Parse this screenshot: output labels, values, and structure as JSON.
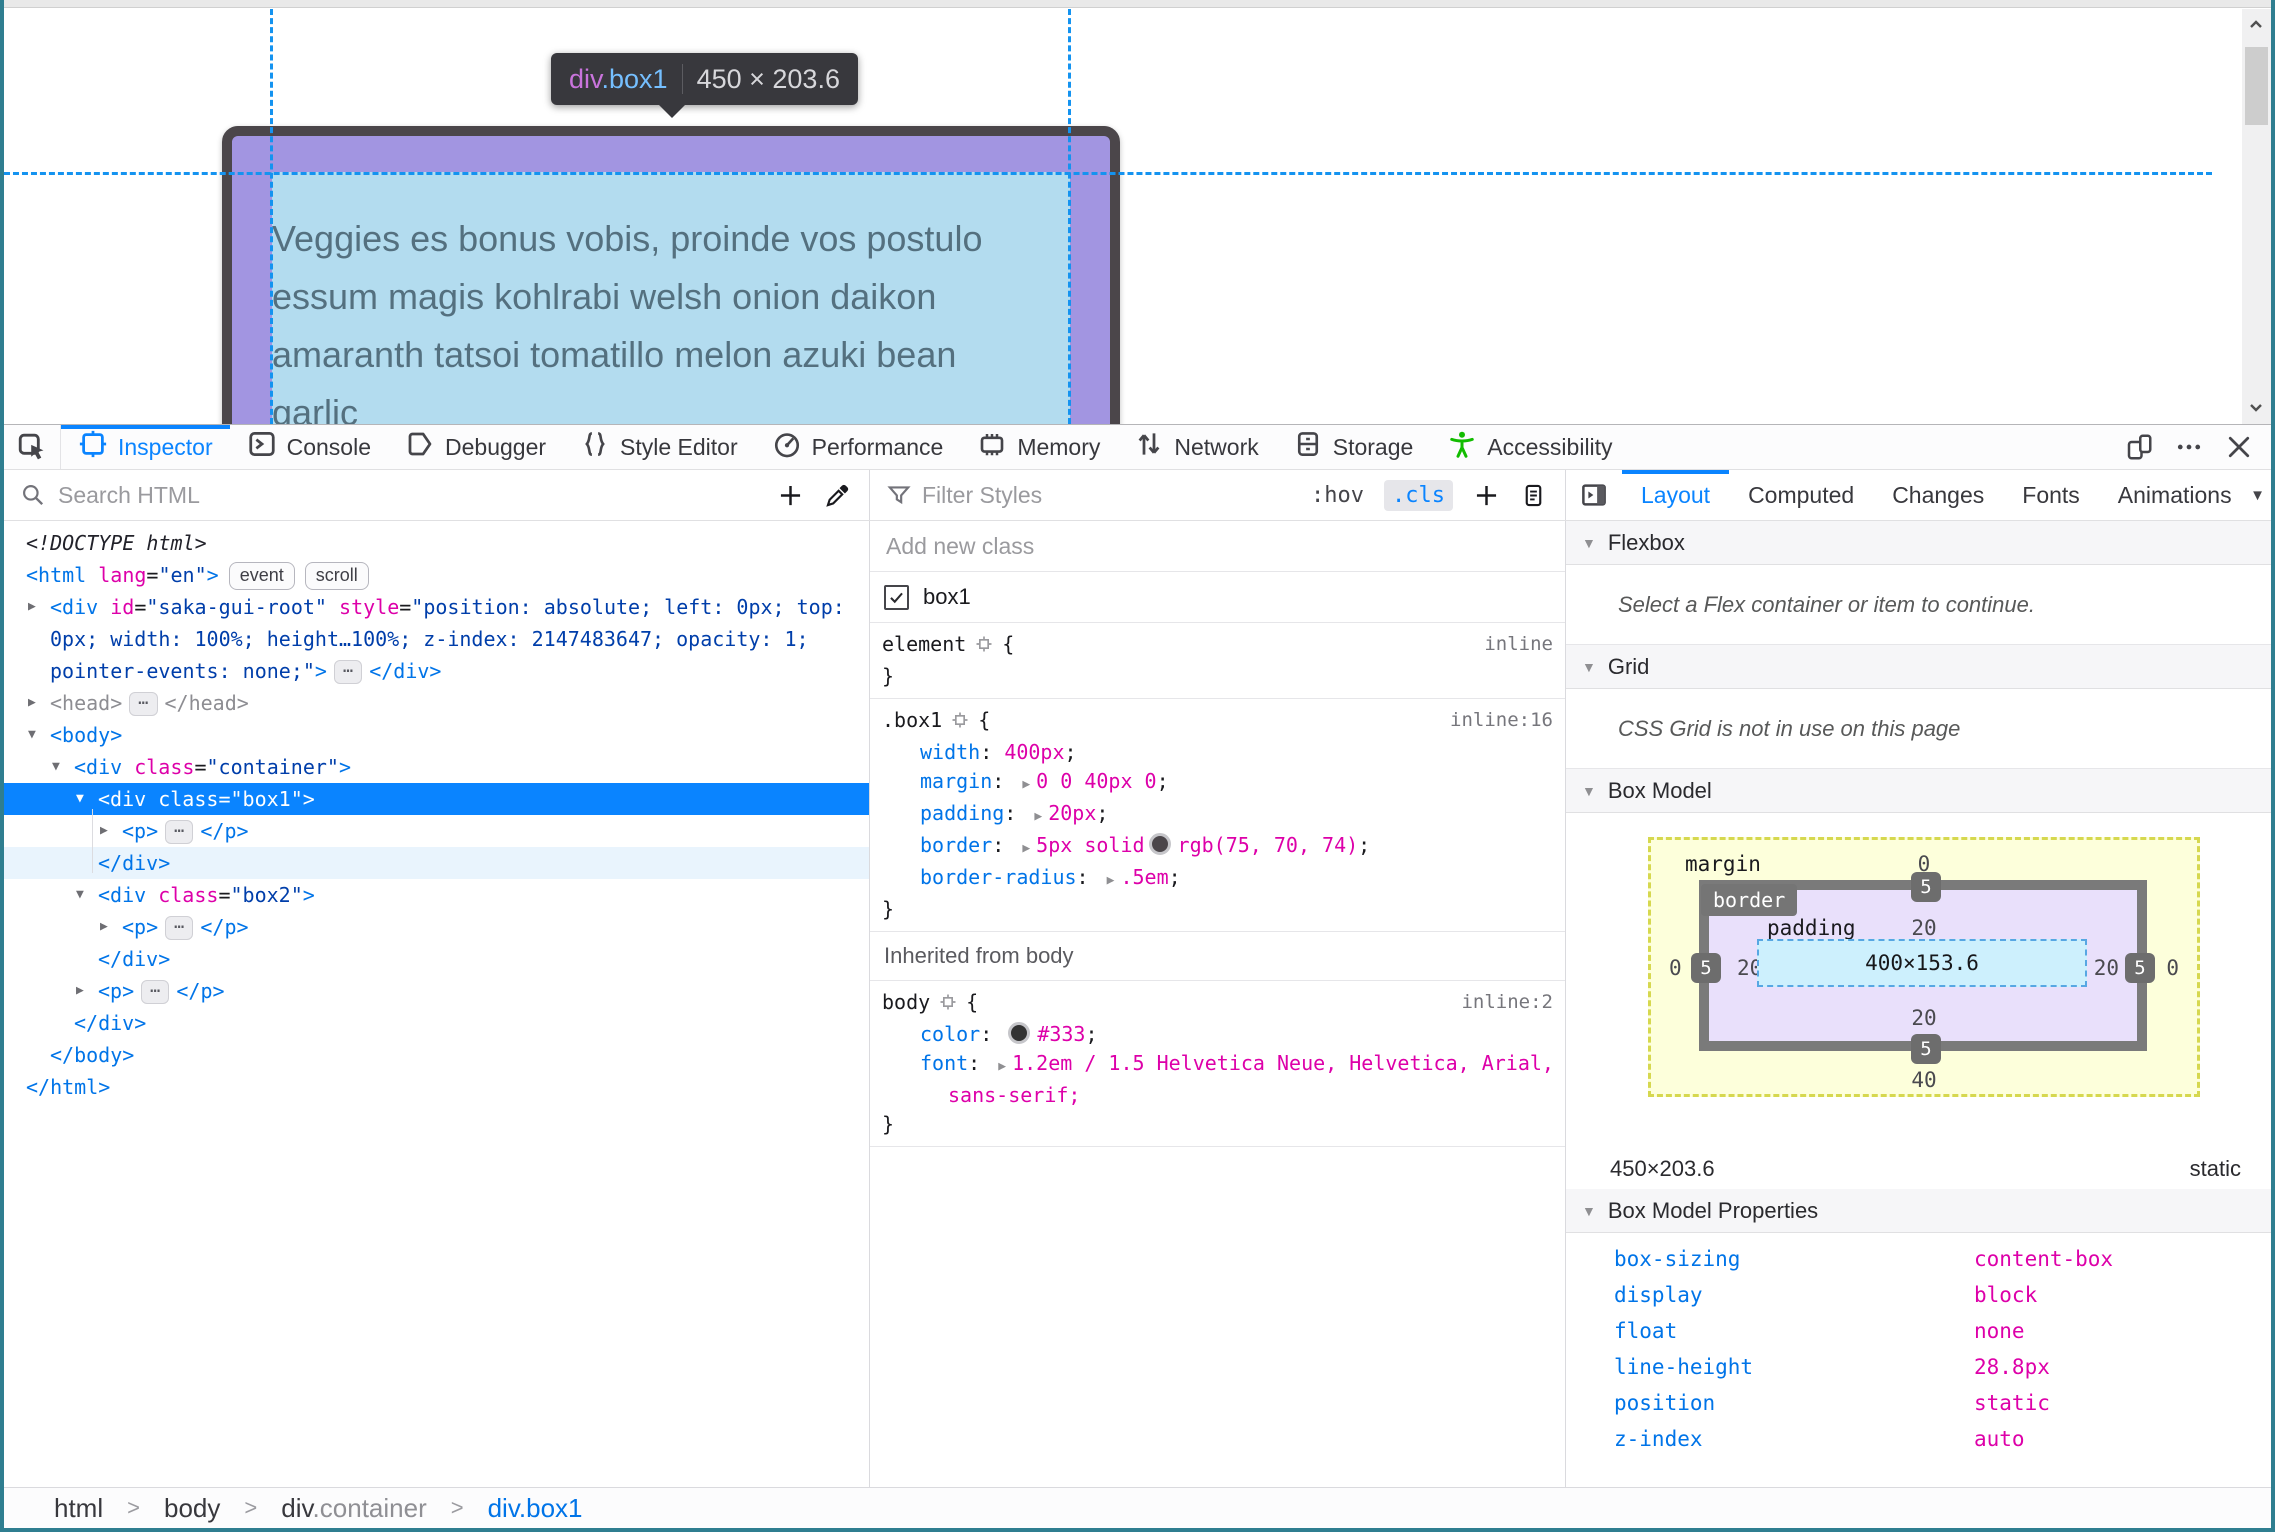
{
  "colors": {
    "accent": "#0a84ff",
    "tag_blue": "#0074e8",
    "attr_magenta": "#dd00a9",
    "attr_value_navy": "#003eaa",
    "css_value_magenta": "#dd00a9",
    "selection_bg": "#0a84ff",
    "window_border_teal": "#2f7e90",
    "guide_blue": "#1493f0",
    "page_box_border": "#4b464a",
    "padding_overlay": "#a295e1",
    "content_overlay": "#b3dcef",
    "accessibility_green": "#12bc00",
    "tooltip_bg": "#38383d"
  },
  "page": {
    "tooltip": {
      "tag": "div",
      "cls": ".box1",
      "dims": "450 × 203.6"
    },
    "paragraph_lines": [
      "Veggies es bonus vobis, proinde vos postulo",
      "essum magis kohlrabi welsh onion daikon",
      "amaranth tatsoi tomatillo melon azuki bean",
      "garlic"
    ]
  },
  "devtools": {
    "tabs": [
      {
        "label": "Inspector",
        "icon": "inspector",
        "active": true
      },
      {
        "label": "Console",
        "icon": "console"
      },
      {
        "label": "Debugger",
        "icon": "debugger"
      },
      {
        "label": "Style Editor",
        "icon": "style-editor"
      },
      {
        "label": "Performance",
        "icon": "performance"
      },
      {
        "label": "Memory",
        "icon": "memory"
      },
      {
        "label": "Network",
        "icon": "network"
      },
      {
        "label": "Storage",
        "icon": "storage"
      },
      {
        "label": "Accessibility",
        "icon": "accessibility"
      }
    ],
    "window_controls": [
      "responsive-design-mode",
      "meatball-menu",
      "close"
    ]
  },
  "toolbar2": {
    "search_placeholder": "Search HTML",
    "filter_placeholder": "Filter Styles",
    "hov": ":hov",
    "cls": ".cls"
  },
  "sidebar_tabs": [
    "Layout",
    "Computed",
    "Changes",
    "Fonts",
    "Animations"
  ],
  "markup": {
    "rows": [
      {
        "l": 0,
        "segs": [
          [
            "<!DOCTYPE html>",
            "d"
          ]
        ]
      },
      {
        "l": 0,
        "segs": [
          [
            "<html ",
            "t"
          ],
          [
            "lang",
            "a"
          ],
          [
            "=",
            "p"
          ],
          [
            "\"en\"",
            "v"
          ],
          [
            ">",
            "t"
          ],
          [
            "event",
            "b"
          ],
          [
            "scroll",
            "b"
          ]
        ]
      },
      {
        "l": 1,
        "a": "r",
        "segs": [
          [
            "<div ",
            "t"
          ],
          [
            "id",
            "a"
          ],
          [
            "=",
            "p"
          ],
          [
            "\"saka-gui-root\"",
            "v"
          ],
          [
            " ",
            "p"
          ],
          [
            "style",
            "a"
          ],
          [
            "=",
            "p"
          ],
          [
            "\"position: absolute; left: 0px; top:",
            "v"
          ]
        ]
      },
      {
        "l": 1,
        "segs": [
          [
            "0px; width: 100%; height…100%; z-index: 2147483647; opacity: 1;",
            "v"
          ]
        ]
      },
      {
        "l": 1,
        "segs": [
          [
            "pointer-events: none;\"",
            "v"
          ],
          [
            ">",
            "t"
          ],
          [
            "⋯",
            "c"
          ],
          [
            "</div>",
            "t"
          ]
        ]
      },
      {
        "l": 1,
        "a": "r",
        "segs": [
          [
            "<head>",
            "g"
          ],
          [
            "⋯",
            "c"
          ],
          [
            "</head>",
            "g"
          ]
        ]
      },
      {
        "l": 1,
        "a": "d",
        "segs": [
          [
            "<body>",
            "t"
          ]
        ]
      },
      {
        "l": 2,
        "a": "d",
        "segs": [
          [
            "<div ",
            "t"
          ],
          [
            "class",
            "a"
          ],
          [
            "=",
            "p"
          ],
          [
            "\"container\"",
            "v"
          ],
          [
            ">",
            "t"
          ]
        ]
      },
      {
        "l": 3,
        "a": "d",
        "sel": true,
        "segs": [
          [
            "<div ",
            "t"
          ],
          [
            "class",
            "a"
          ],
          [
            "=",
            "p"
          ],
          [
            "\"box1\"",
            "v"
          ],
          [
            ">",
            "t"
          ]
        ]
      },
      {
        "l": 4,
        "a": "r",
        "segs": [
          [
            "<p>",
            "t"
          ],
          [
            "⋯",
            "c"
          ],
          [
            "</p>",
            "t"
          ]
        ]
      },
      {
        "l": 3,
        "close": true,
        "segs": [
          [
            "</div>",
            "t"
          ]
        ]
      },
      {
        "l": 3,
        "a": "d",
        "segs": [
          [
            "<div ",
            "t"
          ],
          [
            "class",
            "a"
          ],
          [
            "=",
            "p"
          ],
          [
            "\"box2\"",
            "v"
          ],
          [
            ">",
            "t"
          ]
        ]
      },
      {
        "l": 4,
        "a": "r",
        "segs": [
          [
            "<p>",
            "t"
          ],
          [
            "⋯",
            "c"
          ],
          [
            "</p>",
            "t"
          ]
        ]
      },
      {
        "l": 3,
        "segs": [
          [
            "</div>",
            "t"
          ]
        ]
      },
      {
        "l": 3,
        "a": "r",
        "segs": [
          [
            "<p>",
            "t"
          ],
          [
            "⋯",
            "c"
          ],
          [
            "</p>",
            "t"
          ]
        ]
      },
      {
        "l": 2,
        "segs": [
          [
            "</div>",
            "t"
          ]
        ]
      },
      {
        "l": 1,
        "segs": [
          [
            "</body>",
            "t"
          ]
        ]
      },
      {
        "l": 0,
        "segs": [
          [
            "</html>",
            "t"
          ]
        ]
      }
    ]
  },
  "rules": {
    "add_class_placeholder": "Add new class",
    "class_toggle": "box1",
    "blocks": [
      {
        "selector": "element",
        "link": "inline",
        "decls": []
      },
      {
        "selector": ".box1",
        "link": "inline:16",
        "decls": [
          {
            "n": "width",
            "v": [
              [
                "400px",
                "val"
              ]
            ]
          },
          {
            "n": "margin",
            "e": true,
            "v": [
              [
                "0 0 40px 0",
                "val"
              ]
            ]
          },
          {
            "n": "padding",
            "e": true,
            "v": [
              [
                "20px",
                "val"
              ]
            ]
          },
          {
            "n": "border",
            "e": true,
            "v": [
              [
                "5px solid",
                "val"
              ],
              [
                "#4b464a",
                "sw"
              ],
              [
                "rgb(75, 70, 74)",
                "val"
              ]
            ]
          },
          {
            "n": "border-radius",
            "e": true,
            "v": [
              [
                ".5em",
                "val"
              ]
            ]
          }
        ]
      }
    ],
    "inherited_label": "Inherited from body",
    "inherited_blocks": [
      {
        "selector": "body",
        "link": "inline:2",
        "decls": [
          {
            "n": "color",
            "v": [
              [
                "#333333",
                "sw"
              ],
              [
                "#333",
                "val"
              ]
            ]
          },
          {
            "n": "font",
            "e": true,
            "v": [
              [
                "1.2em / 1.5 Helvetica Neue, Helvetica, Arial,",
                "val"
              ]
            ],
            "wrap": "sans-serif;"
          }
        ]
      }
    ]
  },
  "layout": {
    "flexbox": {
      "title": "Flexbox",
      "message": "Select a Flex container or item to continue."
    },
    "grid": {
      "title": "Grid",
      "message": "CSS Grid is not in use on this page"
    },
    "boxmodel": {
      "title": "Box Model",
      "labels": {
        "margin": "margin",
        "border": "border",
        "padding": "padding"
      },
      "margin": {
        "top": "0",
        "right": "0",
        "bottom": "40",
        "left": "0"
      },
      "border": {
        "top": "5",
        "right": "5",
        "bottom": "5",
        "left": "5"
      },
      "padding": {
        "top": "20",
        "right": "20",
        "bottom": "20",
        "left": "20"
      },
      "content": "400×153.6",
      "dims": "450×203.6",
      "position": "static"
    },
    "props_title": "Box Model Properties",
    "props": [
      {
        "n": "box-sizing",
        "v": "content-box"
      },
      {
        "n": "display",
        "v": "block"
      },
      {
        "n": "float",
        "v": "none"
      },
      {
        "n": "line-height",
        "v": "28.8px"
      },
      {
        "n": "position",
        "v": "static"
      },
      {
        "n": "z-index",
        "v": "auto"
      }
    ]
  },
  "breadcrumb": [
    {
      "text": "html"
    },
    {
      "text": "body"
    },
    {
      "text": "div",
      "muted": ".container"
    },
    {
      "text": "div.box1",
      "active": true
    }
  ]
}
